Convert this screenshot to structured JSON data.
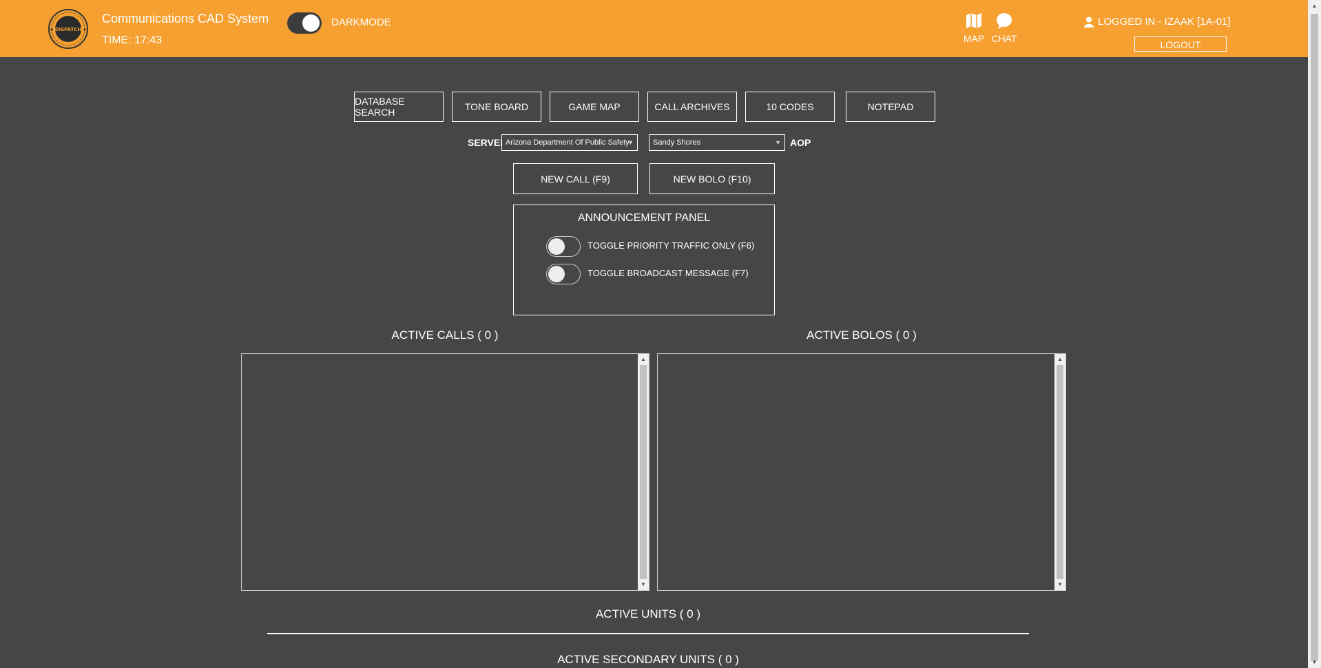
{
  "header": {
    "logo_icon": "dispatch-badge-logo",
    "logo_text": "DISPATCH",
    "app_title": "Communications CAD System",
    "time": "TIME: 17:43",
    "darkmode_label": "DARKMODE",
    "darkmode_on": true,
    "map_label": "MAP",
    "chat_label": "CHAT",
    "user_label": "LOGGED IN - IZAAK [1A-01]",
    "logout_label": "LOGOUT",
    "accent_color": "#f5a030"
  },
  "toolbar": {
    "buttons": [
      "DATABASE SEARCH",
      "TONE BOARD",
      "GAME MAP",
      "CALL ARCHIVES",
      "10 CODES",
      "NOTEPAD"
    ]
  },
  "server": {
    "server_label": "SERVER",
    "server_value": "Arizona Department Of Public Safety",
    "aop_value": "Sandy Shores",
    "aop_label": "AOP"
  },
  "actions": {
    "new_call": "NEW CALL (F9)",
    "new_bolo": "NEW BOLO (F10)"
  },
  "announcement": {
    "title": "ANNOUNCEMENT PANEL",
    "priority_label": "TOGGLE PRIORITY TRAFFIC ONLY (F6)",
    "broadcast_label": "TOGGLE BROADCAST MESSAGE (F7)"
  },
  "lists": {
    "active_calls": "ACTIVE CALLS ( 0 )",
    "active_bolos": "ACTIVE BOLOS ( 0 )",
    "active_units": "ACTIVE UNITS ( 0 )",
    "active_secondary_units": "ACTIVE SECONDARY UNITS ( 0 )"
  }
}
